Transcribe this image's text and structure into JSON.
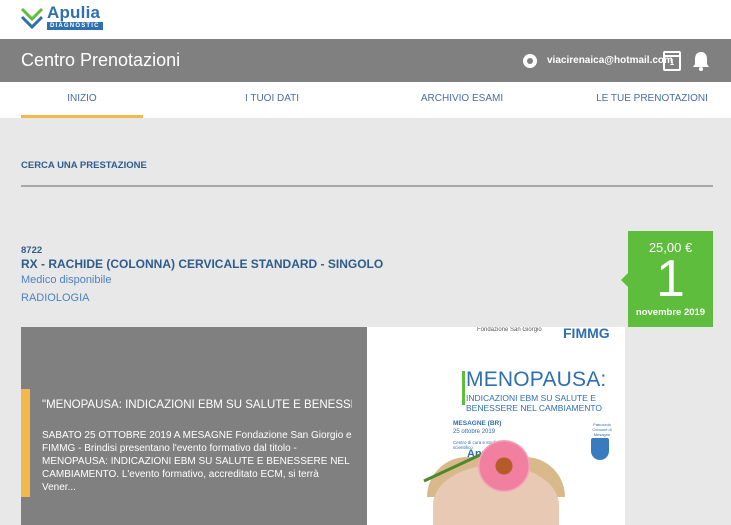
{
  "logo": {
    "name": "Apulia",
    "subtitle": "DIAGNOSTIC"
  },
  "header": {
    "title": "Centro Prenotazioni",
    "email": "viacirenaica@hotmail.com",
    "calendar_badge": "1"
  },
  "nav": {
    "tabs": [
      {
        "label": "INIZIO",
        "active": true
      },
      {
        "label": "I TUOI DATI",
        "active": false
      },
      {
        "label": "ARCHIVIO ESAMI",
        "active": false
      },
      {
        "label": "LE TUE PRENOTAZIONI",
        "active": false
      }
    ]
  },
  "search": {
    "label": "CERCA UNA PRESTAZIONE"
  },
  "exam": {
    "code": "8722",
    "title": "RX - RACHIDE (COLONNA) CERVICALE STANDARD - SINGOLO",
    "doctor": "Medico disponibile",
    "department": "RADIOLOGIA",
    "price": "25,00 €",
    "day": "1",
    "month": "novembre 2019"
  },
  "news": {
    "title": "\"MENOPAUSA: INDICAZIONI EBM SU SALUTE E BENESSER...",
    "text": "SABATO 25 OTTOBRE 2019 A MESAGNE   Fondazione San Giorgio e FIMMG - Brindisi presentano l'evento formativo dal titolo - MENOPAUSA: INDICAZIONI EBM SU SALUTE E BENESSERE NEL CAMBIAMENTO. L'evento formativo, accreditato ECM, si terrà Vener...",
    "poster": {
      "heading": "MENOPAUSA:",
      "subheading": "INDICAZIONI EBM SU SALUTE E BENESSERE NEL CAMBIAMENTO",
      "place": "MESAGNE (BR)",
      "date": "25 ottobre 2019",
      "sponsor": "Centro di cura e studio scientifico",
      "brand": "Apulia",
      "foundation": "Fondazione San Giorgio",
      "fimmg": "FIMMG",
      "crest_label": "Patrocinio Comune di Mesagne"
    }
  },
  "colors": {
    "accent": "#f2b84b",
    "green": "#5ebd3c",
    "blue": "#2d5c8c",
    "header": "#808080"
  }
}
